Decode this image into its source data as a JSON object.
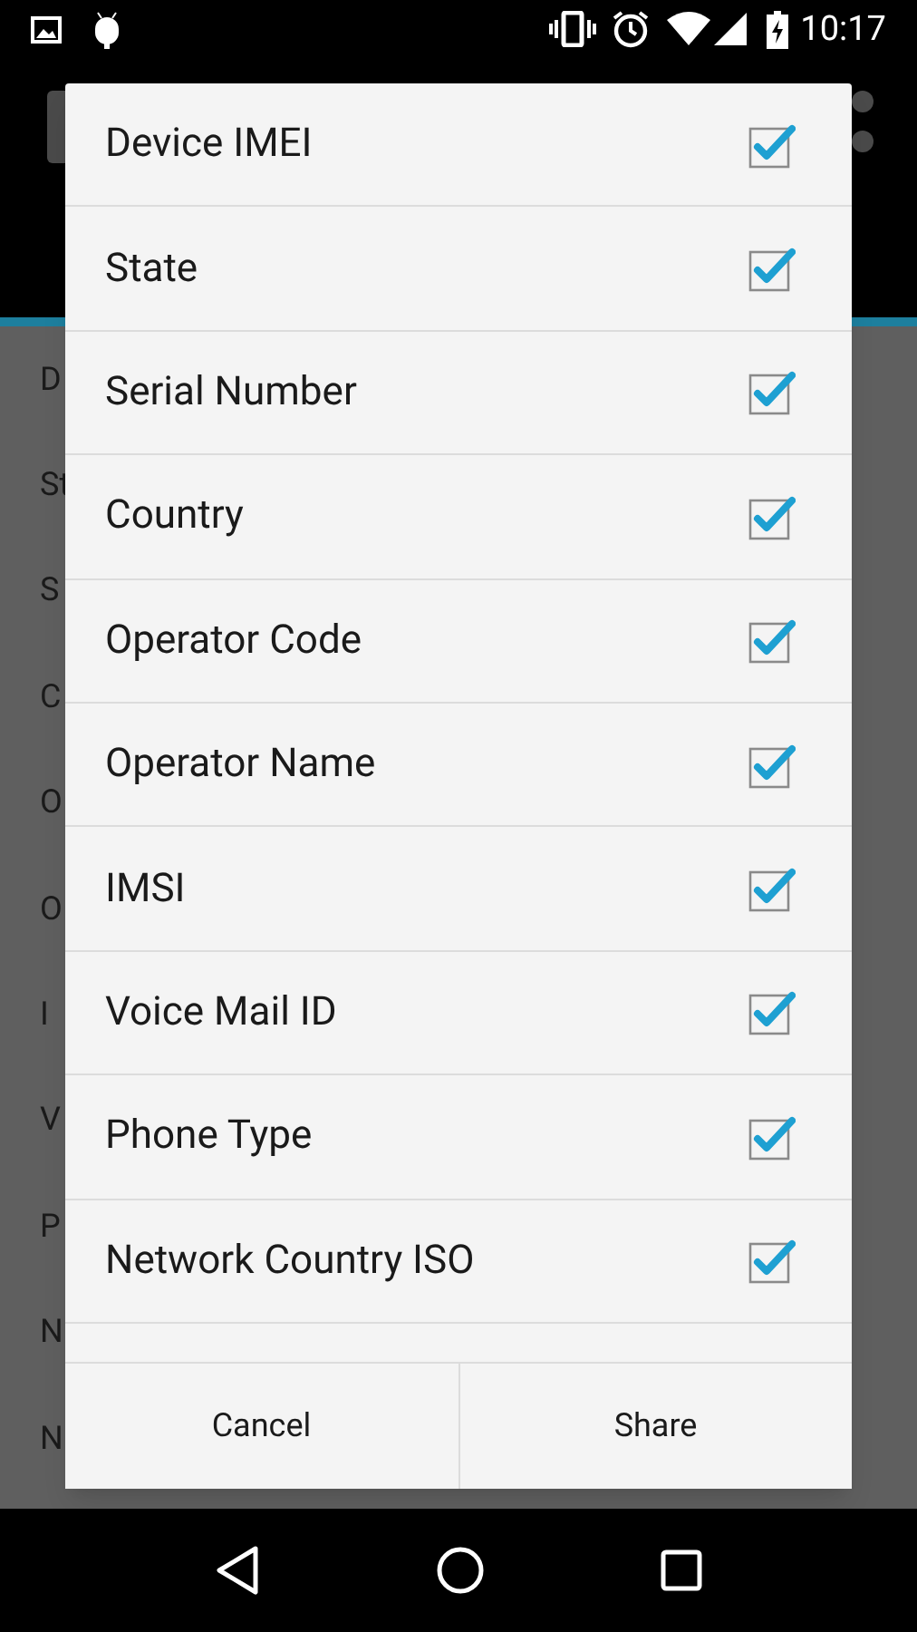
{
  "status_bar": {
    "time": "10:17"
  },
  "background_list": [
    "D",
    "St",
    "S",
    "C",
    "O",
    "O",
    "I",
    "V",
    "P",
    "N",
    "N"
  ],
  "dialog": {
    "items": [
      {
        "label": "Device IMEI",
        "checked": true
      },
      {
        "label": "State",
        "checked": true
      },
      {
        "label": "Serial Number",
        "checked": true
      },
      {
        "label": "Country",
        "checked": true
      },
      {
        "label": "Operator Code",
        "checked": true
      },
      {
        "label": "Operator Name",
        "checked": true
      },
      {
        "label": "IMSI",
        "checked": true
      },
      {
        "label": "Voice Mail ID",
        "checked": true
      },
      {
        "label": "Phone Type",
        "checked": true
      },
      {
        "label": "Network Country ISO",
        "checked": true
      }
    ],
    "buttons": [
      "Cancel",
      "Share"
    ]
  }
}
